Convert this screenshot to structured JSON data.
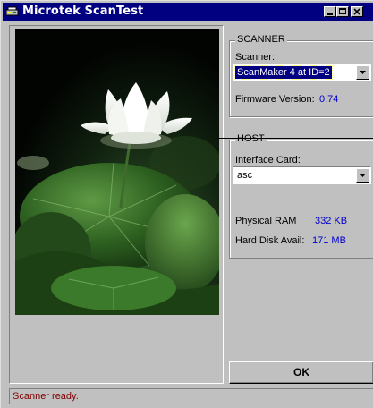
{
  "window": {
    "title": "Microtek ScanTest",
    "controls": [
      "minimize-icon",
      "maximize-icon",
      "close-icon"
    ]
  },
  "scanner": {
    "group_label": "SCANNER",
    "scanner_label": "Scanner:",
    "scanner_value": "ScanMaker 4 at ID=2",
    "firmware_label": "Firmware Version:",
    "firmware_value": "0.74"
  },
  "host": {
    "group_label": "HOST",
    "interface_label": "Interface Card:",
    "interface_value": "asc",
    "ram_label": "Physical RAM",
    "ram_value": "332 KB",
    "disk_label": "Hard Disk Avail:",
    "disk_value": "171 MB"
  },
  "ok_label": "OK",
  "status": "Scanner ready.",
  "colors": {
    "title_bar": "#000080",
    "value_text": "#0000cc",
    "status_text": "#800000",
    "face": "#c0c0c0"
  },
  "preview": {
    "subject": "white lotus flower with green leaves on dark background"
  }
}
